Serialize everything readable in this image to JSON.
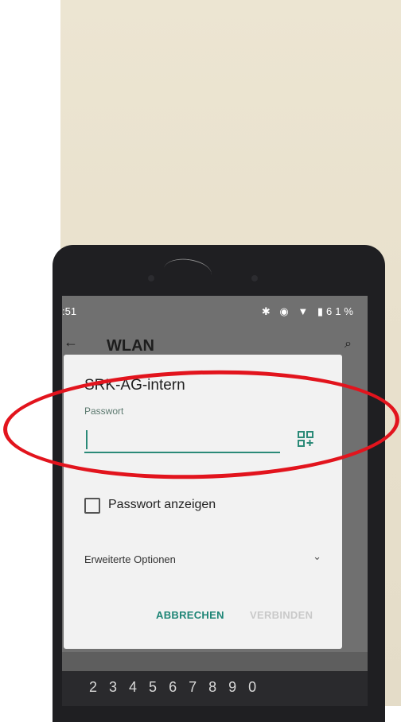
{
  "status_bar": {
    "time": ":51",
    "icons": "✱ ◉ ▼ ▮",
    "battery": "61%"
  },
  "app_bar": {
    "title": "WLAN"
  },
  "dialog": {
    "network_name": "SRK-AG-intern",
    "password_label": "Passwort",
    "password_value": "",
    "show_password_label": "Passwort anzeigen",
    "show_password_checked": false,
    "advanced_options_label": "Erweiterte Optionen",
    "cancel_label": "ABBRECHEN",
    "connect_label": "VERBINDEN"
  },
  "keyboard": {
    "digits": [
      "2",
      "3",
      "4",
      "5",
      "6",
      "7",
      "8",
      "9",
      "0"
    ]
  },
  "annotation": {
    "color": "#e2141d"
  },
  "icons": {
    "back": "back-arrow-icon",
    "search": "search-icon",
    "qr": "qr-code-scan-icon",
    "chevron": "chevron-down-icon"
  }
}
